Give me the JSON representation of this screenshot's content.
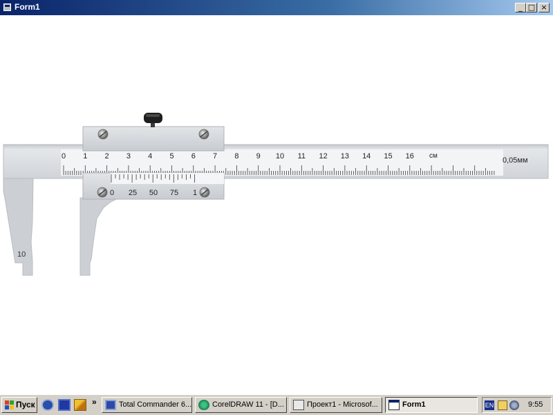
{
  "window": {
    "title": "Form1",
    "minimize_glyph": "_",
    "maximize_glyph": "□",
    "close_glyph": "×"
  },
  "caliper": {
    "main_scale_labels": [
      "0",
      "1",
      "2",
      "3",
      "4",
      "5",
      "6",
      "7",
      "8",
      "9",
      "10",
      "11",
      "12",
      "13",
      "14",
      "15",
      "16"
    ],
    "unit_label": "см",
    "precision_label": "0,05мм",
    "vernier_labels": [
      "0",
      "25",
      "50",
      "75",
      "1"
    ],
    "jaw_label": "10",
    "colors": {
      "body": "#d3d6db",
      "scale_face": "#f3f5f6",
      "slider": "#cfd2d6",
      "jaw": "#cdd0d5",
      "tick": "#3a3a3a"
    }
  },
  "taskbar": {
    "start_label": "Пуск",
    "quick_launch_icons": [
      "bs-player-icon",
      "floppy-save-icon",
      "pencil-tool-icon"
    ],
    "overflow_label": "»",
    "tasks": [
      {
        "label": "Total Commander 6...",
        "icon": "floppy-disk-icon",
        "active": false
      },
      {
        "label": "CorelDRAW 11 - [D...",
        "icon": "corel-balloon-icon",
        "active": false
      },
      {
        "label": "Проект1 - Microsof...",
        "icon": "vb-project-icon",
        "active": false
      },
      {
        "label": "Form1",
        "icon": "form-window-icon",
        "active": true
      }
    ],
    "tray": {
      "language": "EN",
      "clock": "9:55"
    }
  }
}
